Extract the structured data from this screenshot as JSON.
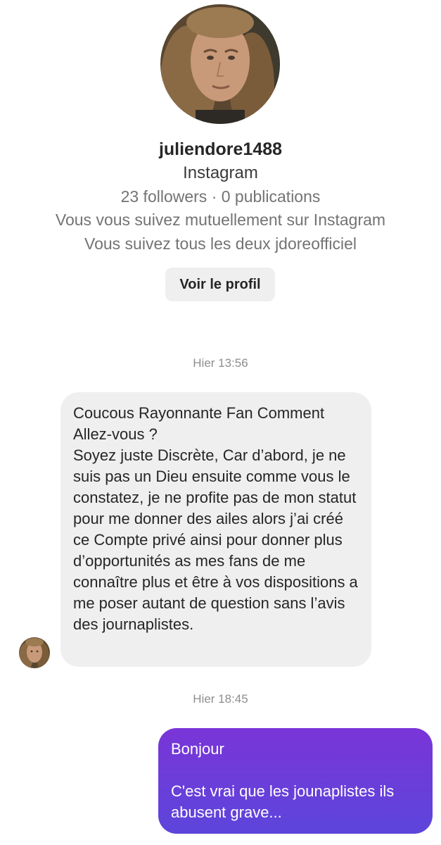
{
  "profile": {
    "avatar_icon": "profile-photo-icon",
    "username": "juliendore1488",
    "platform": "Instagram",
    "stats": "23 followers · 0 publications",
    "mutual_follow": "Vous vous suivez mutuellement sur Instagram",
    "common_follow": "Vous suivez tous les deux jdoreofficiel",
    "view_profile_label": "Voir le profil"
  },
  "messages": [
    {
      "timestamp": "Hier 13:56",
      "direction": "incoming",
      "text": "Coucous Rayonnante Fan Comment Allez-vous ?\nSoyez juste Discrète, Car d’abord, je ne suis pas un Dieu ensuite comme vous le constatez, je ne profite pas de mon statut pour me donner des ailes alors j’ai créé ce Compte privé ainsi pour donner plus d’opportunités as mes fans de me connaître plus et être à vos dispositions a me poser autant de question sans l’avis des journaplistes."
    },
    {
      "timestamp": "Hier 18:45",
      "direction": "outgoing",
      "text": "Bonjour\n\nC'est vrai que les jounaplistes ils abusent grave..."
    }
  ],
  "colors": {
    "outgoing_bubble_start": "#7a35d8",
    "outgoing_bubble_end": "#5c45da",
    "incoming_bubble": "#efefef",
    "button_bg": "#efefef"
  }
}
